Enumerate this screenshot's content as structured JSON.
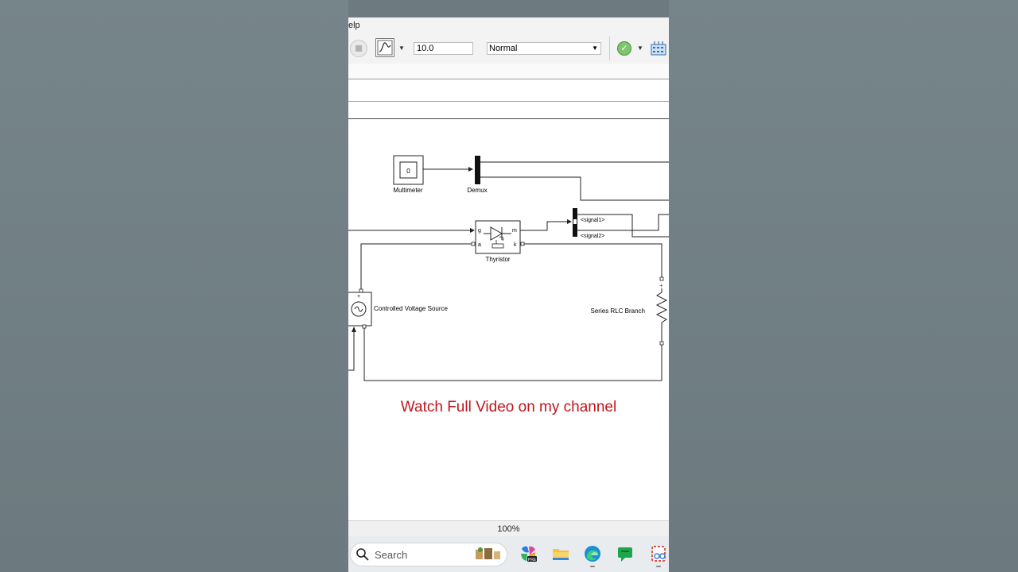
{
  "menubar": {
    "text": "elp"
  },
  "toolbar": {
    "stop_time": "10.0",
    "sim_mode": "Normal"
  },
  "diagram": {
    "multimeter": {
      "display": "0",
      "label": "Multimeter"
    },
    "demux": {
      "label": "Demux"
    },
    "thyristor": {
      "label": "Thyristor",
      "port_g": "g",
      "port_m": "m",
      "port_a": "a",
      "port_k": "k"
    },
    "mux_signals": [
      "<signal1>",
      "<signal2>"
    ],
    "voltage_source": {
      "label": "Controlled Voltage Source",
      "plus": "+"
    },
    "rlc": {
      "label": "Series RLC Branch",
      "plus": "+"
    }
  },
  "overlay": {
    "caption": "Watch Full Video on my channel"
  },
  "status": {
    "zoom": "100%"
  },
  "taskbar": {
    "search_placeholder": "Search"
  }
}
